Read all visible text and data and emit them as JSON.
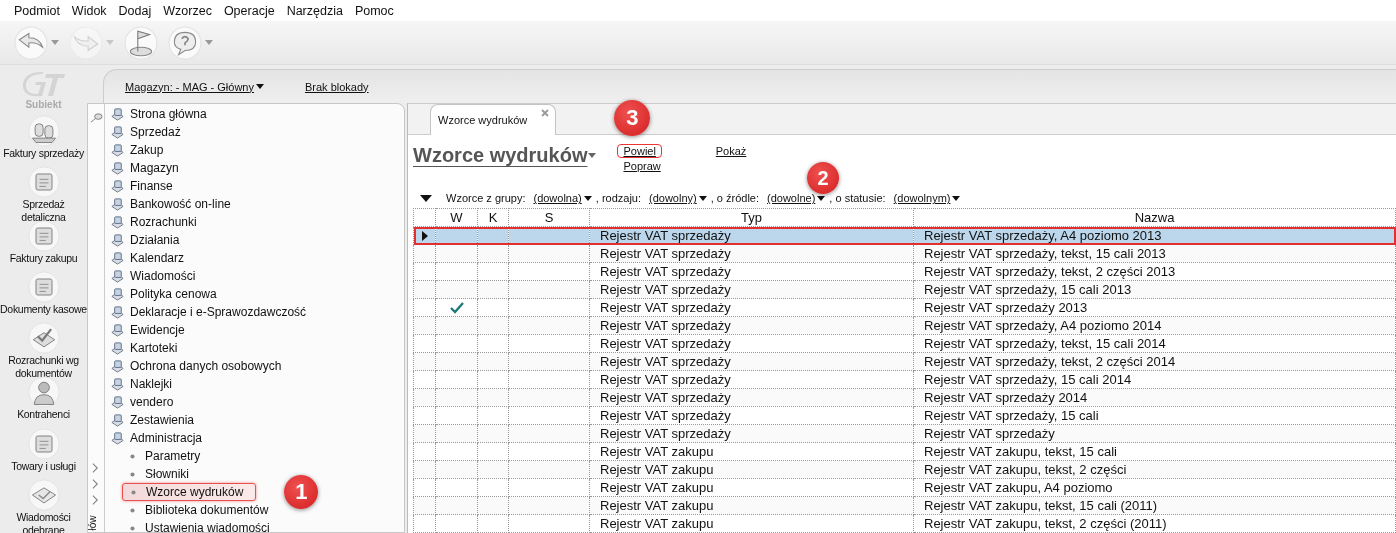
{
  "menu": [
    "Podmiot",
    "Widok",
    "Dodaj",
    "Wzorzec",
    "Operacje",
    "Narzędzia",
    "Pomoc"
  ],
  "toolbar": [
    {
      "has_dropdown": true,
      "disabled": false
    },
    {
      "has_dropdown": true,
      "disabled": true
    },
    {
      "has_dropdown": false,
      "disabled": false
    },
    {
      "has_dropdown": true,
      "disabled": false
    }
  ],
  "logo": {
    "name": "Subiekt"
  },
  "nav": [
    "Faktury sprzedaży",
    "Sprzedaż detaliczna",
    "Faktury zakupu",
    "Dokumenty kasowe",
    "Rozrachunki wg dokumentów",
    "Kontrahenci",
    "Towary i usługi",
    "Wiadomości odebrane"
  ],
  "header": {
    "warehouse": "Magazyn: - MAG - Główny",
    "lock": "Brak blokady"
  },
  "side_strip": {
    "label": "łów"
  },
  "tree": [
    {
      "label": "Strona główna",
      "selected": false
    },
    {
      "label": "Sprzedaż",
      "selected": false
    },
    {
      "label": "Zakup",
      "selected": false
    },
    {
      "label": "Magazyn",
      "selected": false
    },
    {
      "label": "Finanse",
      "selected": false
    },
    {
      "label": "Bankowość on-line",
      "selected": false
    },
    {
      "label": "Rozrachunki",
      "selected": false
    },
    {
      "label": "Działania",
      "selected": false
    },
    {
      "label": "Kalendarz",
      "selected": false
    },
    {
      "label": "Wiadomości",
      "selected": false
    },
    {
      "label": "Polityka cenowa",
      "selected": false
    },
    {
      "label": "Deklaracje i e-Sprawozdawczość",
      "selected": false
    },
    {
      "label": "Ewidencje",
      "selected": false
    },
    {
      "label": "Kartoteki",
      "selected": false
    },
    {
      "label": "Ochrona danych osobowych",
      "selected": false
    },
    {
      "label": "Naklejki",
      "selected": false
    },
    {
      "label": "vendero",
      "selected": false
    },
    {
      "label": "Zestawienia",
      "selected": false
    },
    {
      "label": "Administracja",
      "selected": false,
      "children": [
        {
          "label": "Parametry",
          "selected": false
        },
        {
          "label": "Słowniki",
          "selected": false
        },
        {
          "label": "Wzorce wydruków",
          "selected": true,
          "callout": "1"
        },
        {
          "label": "Biblioteka dokumentów",
          "selected": false
        },
        {
          "label": "Ustawienia wiadomości",
          "selected": false
        }
      ]
    }
  ],
  "tab": {
    "label": "Wzorce wydruków"
  },
  "title": "Wzorce wydruków",
  "action_groups": [
    [
      {
        "label": "Powiel",
        "callout": "3"
      },
      {
        "label": "Popraw"
      }
    ],
    [
      {
        "label": "Pokaż"
      }
    ]
  ],
  "filter": [
    {
      "kind": "label",
      "text": "Wzorce z grupy:"
    },
    {
      "kind": "dropdown",
      "text": "(dowolna)"
    },
    {
      "kind": "label",
      "text": ", rodzaju:"
    },
    {
      "kind": "dropdown",
      "text": "(dowolny)"
    },
    {
      "kind": "label",
      "text": ", o źródle:"
    },
    {
      "kind": "dropdown",
      "text": "(dowolne)",
      "callout": "2"
    },
    {
      "kind": "label",
      "text": ", o statusie:"
    },
    {
      "kind": "dropdown",
      "text": "(dowolnym)"
    }
  ],
  "table": {
    "columns": [
      "W",
      "K",
      "S",
      "Typ",
      "Nazwa"
    ],
    "rows": [
      {
        "selected": true,
        "outlined": true,
        "w_checked": false,
        "typ": "Rejestr VAT sprzedaży",
        "nazwa": "Rejestr VAT sprzedaży, A4 poziomo 2013"
      },
      {
        "selected": false,
        "outlined": false,
        "w_checked": false,
        "typ": "Rejestr VAT sprzedaży",
        "nazwa": "Rejestr VAT sprzedaży, tekst, 15 cali 2013"
      },
      {
        "selected": false,
        "outlined": false,
        "w_checked": false,
        "typ": "Rejestr VAT sprzedaży",
        "nazwa": "Rejestr VAT sprzedaży, tekst, 2 części 2013"
      },
      {
        "selected": false,
        "outlined": false,
        "w_checked": false,
        "typ": "Rejestr VAT sprzedaży",
        "nazwa": "Rejestr VAT sprzedaży, 15 cali 2013"
      },
      {
        "selected": false,
        "outlined": false,
        "w_checked": true,
        "typ": "Rejestr VAT sprzedaży",
        "nazwa": "Rejestr VAT sprzedaży 2013"
      },
      {
        "selected": false,
        "outlined": false,
        "w_checked": false,
        "typ": "Rejestr VAT sprzedaży",
        "nazwa": "Rejestr VAT sprzedaży, A4 poziomo 2014"
      },
      {
        "selected": false,
        "outlined": false,
        "w_checked": false,
        "typ": "Rejestr VAT sprzedaży",
        "nazwa": "Rejestr VAT sprzedaży, tekst, 15 cali 2014"
      },
      {
        "selected": false,
        "outlined": false,
        "w_checked": false,
        "typ": "Rejestr VAT sprzedaży",
        "nazwa": "Rejestr VAT sprzedaży, tekst, 2 części 2014"
      },
      {
        "selected": false,
        "outlined": false,
        "w_checked": false,
        "typ": "Rejestr VAT sprzedaży",
        "nazwa": "Rejestr VAT sprzedaży, 15 cali 2014"
      },
      {
        "selected": false,
        "outlined": false,
        "w_checked": false,
        "typ": "Rejestr VAT sprzedaży",
        "nazwa": "Rejestr VAT sprzedaży 2014"
      },
      {
        "selected": false,
        "outlined": false,
        "w_checked": false,
        "typ": "Rejestr VAT sprzedaży",
        "nazwa": "Rejestr VAT sprzedaży, 15 cali"
      },
      {
        "selected": false,
        "outlined": false,
        "w_checked": false,
        "typ": "Rejestr VAT sprzedaży",
        "nazwa": "Rejestr VAT sprzedaży"
      },
      {
        "selected": false,
        "outlined": false,
        "w_checked": false,
        "typ": "Rejestr VAT zakupu",
        "nazwa": "Rejestr VAT zakupu, tekst, 15 cali"
      },
      {
        "selected": false,
        "outlined": false,
        "w_checked": false,
        "typ": "Rejestr VAT zakupu",
        "nazwa": "Rejestr VAT zakupu, tekst, 2 części"
      },
      {
        "selected": false,
        "outlined": false,
        "w_checked": false,
        "typ": "Rejestr VAT zakupu",
        "nazwa": "Rejestr VAT zakupu, A4 poziomo"
      },
      {
        "selected": false,
        "outlined": false,
        "w_checked": false,
        "typ": "Rejestr VAT zakupu",
        "nazwa": "Rejestr VAT zakupu, tekst, 15 cali (2011)"
      },
      {
        "selected": false,
        "outlined": false,
        "w_checked": false,
        "typ": "Rejestr VAT zakupu",
        "nazwa": "Rejestr VAT zakupu, tekst, 2 części (2011)"
      }
    ]
  }
}
